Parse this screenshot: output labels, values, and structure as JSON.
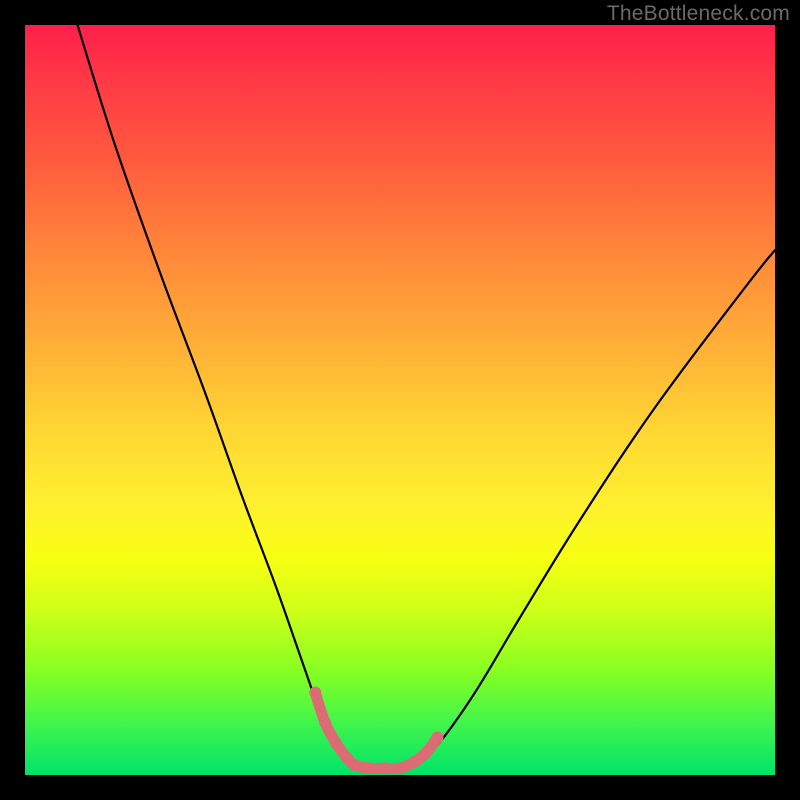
{
  "watermark": "TheBottleneck.com",
  "chart_data": {
    "type": "line",
    "title": "",
    "xlabel": "",
    "ylabel": "",
    "xlim": [
      0,
      100
    ],
    "ylim": [
      0,
      100
    ],
    "grid": false,
    "legend": false,
    "gradient_colors": {
      "top": "#ff1f4a",
      "mid_upper": "#ffad37",
      "mid_lower": "#fff02f",
      "bottom": "#00e36a"
    },
    "series": [
      {
        "name": "main_curve_black",
        "color": "#000000",
        "x": [
          7,
          12,
          18,
          24,
          29,
          33.5,
          37,
          39.5,
          41.5,
          43,
          44,
          46,
          48,
          50,
          52,
          55,
          60,
          66,
          74,
          84,
          96,
          100
        ],
        "y": [
          100,
          84,
          67,
          51,
          37,
          25,
          15,
          8,
          4,
          2,
          1,
          0.7,
          0.7,
          0.7,
          1.5,
          4,
          11,
          21,
          34,
          49,
          65,
          70
        ]
      },
      {
        "name": "bottom_highlight_pink",
        "color": "#e46b74",
        "x": [
          38.7,
          40,
          41.5,
          43,
          44,
          46,
          48,
          50,
          52,
          53.5,
          55
        ],
        "y": [
          11,
          7,
          4.2,
          2.2,
          1.3,
          0.9,
          0.9,
          0.9,
          1.8,
          3,
          5
        ]
      }
    ]
  }
}
